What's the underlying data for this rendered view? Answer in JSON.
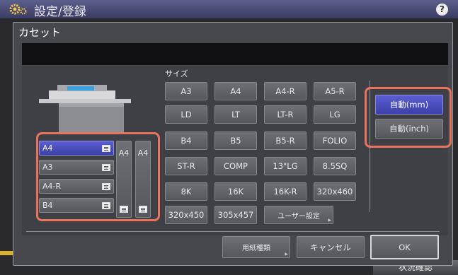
{
  "header": {
    "title": "設定/登録",
    "help_label": "?"
  },
  "dialog": {
    "title": "カセット",
    "message": "",
    "size_label": "サイズ"
  },
  "sizes": {
    "row1": [
      "A3",
      "A4",
      "A4-R",
      "A5-R"
    ],
    "row2": [
      "LD",
      "LT",
      "LT-R",
      "LG"
    ],
    "row3": [
      "B4",
      "B5",
      "B5-R",
      "FOLIO"
    ],
    "row4": [
      "ST-R",
      "COMP",
      "13\"LG",
      "8.5SQ"
    ],
    "row5": [
      "8K",
      "16K",
      "16K-R",
      "320x460"
    ],
    "row6": [
      "320x450",
      "305x457",
      "ユーザー設定"
    ]
  },
  "auto": {
    "mm_label": "自動(mm)",
    "inch_label": "自動(inch)",
    "selected": "mm"
  },
  "cassettes": [
    {
      "label": "A4",
      "selected": true
    },
    {
      "label": "A3",
      "selected": false
    },
    {
      "label": "A4-R",
      "selected": false
    },
    {
      "label": "B4",
      "selected": false
    }
  ],
  "bypass": [
    {
      "label": "A4"
    },
    {
      "label": "A4"
    }
  ],
  "footer": {
    "paper_type_label": "用紙種類",
    "cancel_label": "キャンセル",
    "ok_label": "OK"
  },
  "underlying": {
    "status_label": "状況確認"
  },
  "colors": {
    "selected": "#4a4ec0",
    "highlight": "#e8755b",
    "header": "#4a4c78"
  }
}
